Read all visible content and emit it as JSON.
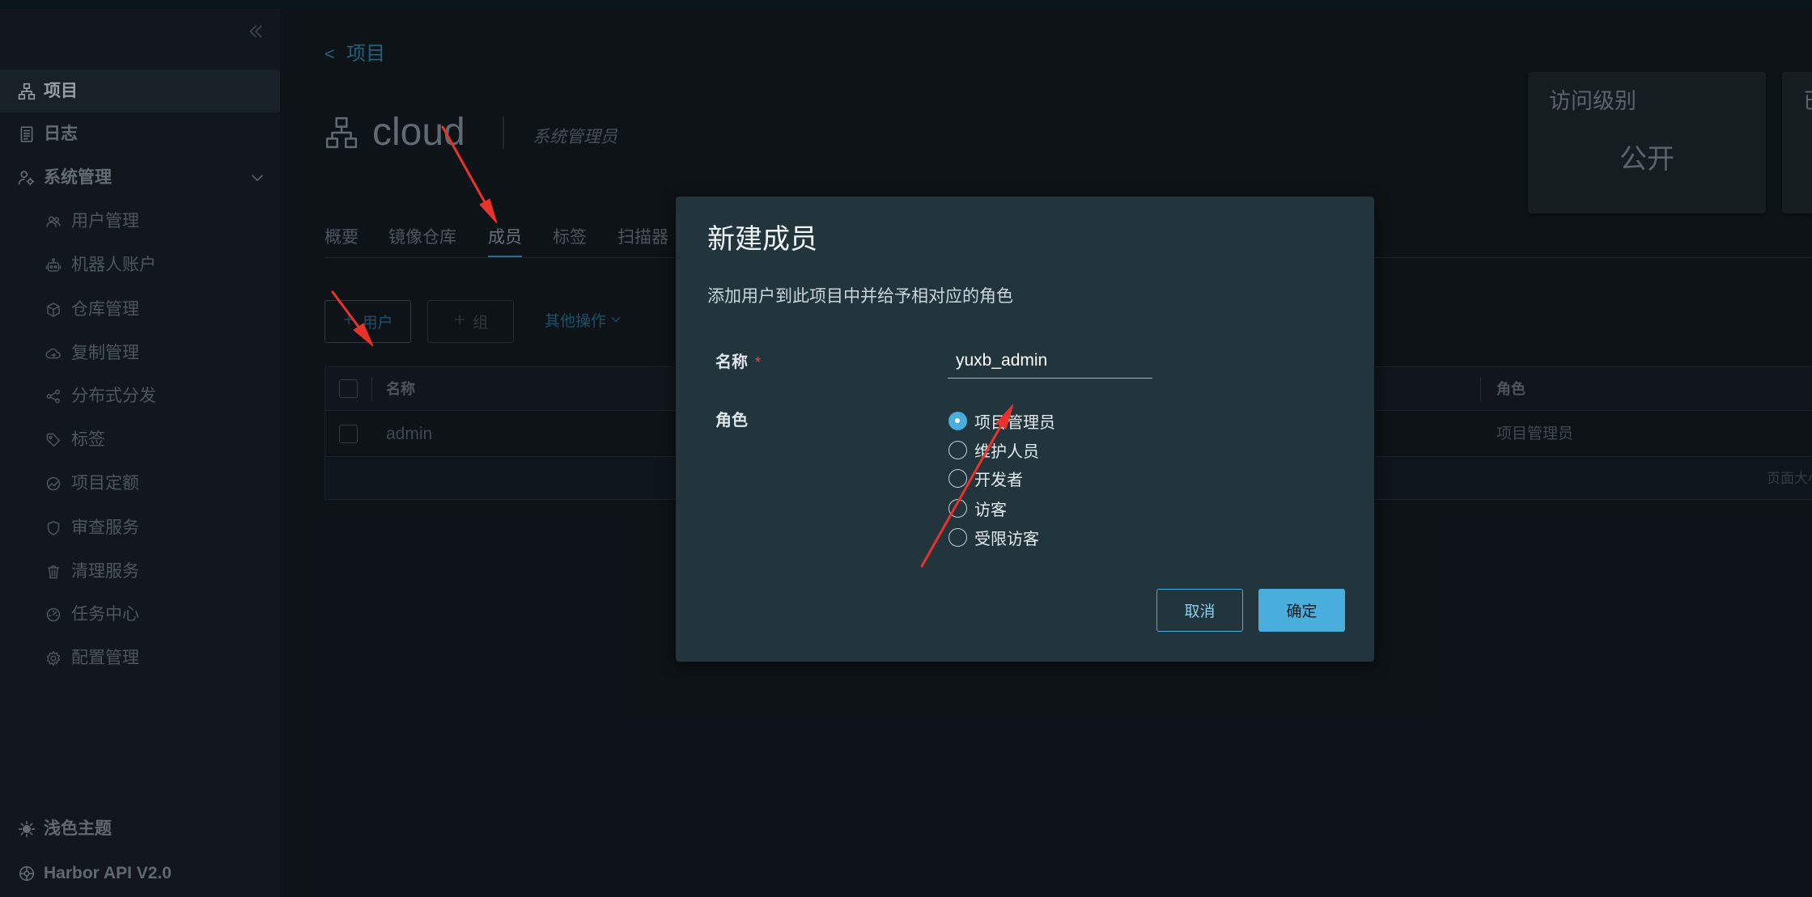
{
  "sidebar": {
    "collapse_icon": "double-chevron-left-icon",
    "nav": [
      {
        "label": "项目",
        "icon": "project-icon",
        "active": true
      },
      {
        "label": "日志",
        "icon": "log-icon",
        "active": false
      },
      {
        "label": "系统管理",
        "icon": "system-admin-icon",
        "active": false,
        "expanded": true
      }
    ],
    "admin_items": [
      {
        "label": "用户管理",
        "icon": "users-icon"
      },
      {
        "label": "机器人账户",
        "icon": "robot-icon"
      },
      {
        "label": "仓库管理",
        "icon": "registry-icon"
      },
      {
        "label": "复制管理",
        "icon": "replication-icon"
      },
      {
        "label": "分布式分发",
        "icon": "distribution-icon"
      },
      {
        "label": "标签",
        "icon": "tag-icon"
      },
      {
        "label": "项目定额",
        "icon": "quota-icon"
      },
      {
        "label": "审查服务",
        "icon": "shield-icon"
      },
      {
        "label": "清理服务",
        "icon": "trash-icon"
      },
      {
        "label": "任务中心",
        "icon": "speedometer-icon"
      },
      {
        "label": "配置管理",
        "icon": "gear-icon"
      }
    ],
    "footer": [
      {
        "label": "浅色主题",
        "icon": "sun-icon"
      },
      {
        "label": "Harbor API V2.0",
        "icon": "api-icon"
      }
    ]
  },
  "breadcrumb": {
    "back": "<",
    "label": "项目"
  },
  "project": {
    "name": "cloud",
    "role": "系统管理员",
    "icon": "project-icon"
  },
  "summary_cards": [
    {
      "title": "访问级别",
      "value": "公开"
    },
    {
      "title": "已"
    }
  ],
  "tabs": [
    {
      "label": "概要",
      "active": false
    },
    {
      "label": "镜像仓库",
      "active": false
    },
    {
      "label": "成员",
      "active": true
    },
    {
      "label": "标签",
      "active": false
    },
    {
      "label": "扫描器",
      "active": false
    }
  ],
  "toolbar": {
    "add_user": "用户",
    "add_group": "组",
    "more_actions": "其他操作",
    "add_icon": "plus-icon"
  },
  "members_table": {
    "columns": [
      "名称",
      "角色"
    ],
    "rows": [
      {
        "name": "admin",
        "role": "项目管理员",
        "checked": false
      }
    ],
    "footer": "页面大小"
  },
  "modal": {
    "title": "新建成员",
    "description": "添加用户到此项目中并给予相对应的角色",
    "name_label": "名称",
    "required_mark": "*",
    "name_value": "yuxb_admin",
    "role_label": "角色",
    "roles": [
      {
        "label": "项目管理员",
        "selected": true
      },
      {
        "label": "维护人员",
        "selected": false
      },
      {
        "label": "开发者",
        "selected": false
      },
      {
        "label": "访客",
        "selected": false
      },
      {
        "label": "受限访客",
        "selected": false
      }
    ],
    "cancel": "取消",
    "confirm": "确定"
  },
  "theme": {
    "accent": "#49aedb",
    "required": "#e0504b",
    "annotation": "#e8322b"
  }
}
